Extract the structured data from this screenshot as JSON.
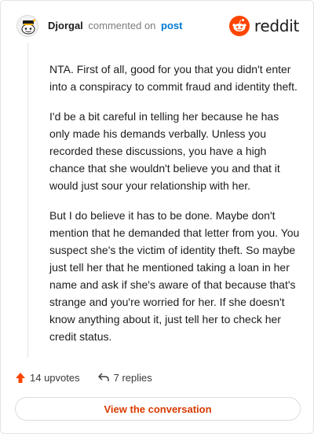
{
  "header": {
    "username": "Djorgal",
    "verb": "commented on",
    "post_link": "post",
    "brand_name": "reddit",
    "brand_color": "#ff4500",
    "avatar_icon": "snoo-avatar-icon"
  },
  "comment": {
    "paragraphs": [
      "NTA. First of all, good for you that you didn't enter into a conspiracy to commit fraud and identity theft.",
      "I'd be a bit careful in telling her because he has only made his demands verbally. Unless you recorded these discussions, you have a high chance that she wouldn't believe you and that it would just sour your relationship with her.",
      "But I do believe it has to be done. Maybe don't mention that he demanded that letter from you. You suspect she's the victim of identity theft. So maybe just tell her that he mentioned taking a loan in her name and ask if she's aware of that because that's strange and you're worried for her. If she doesn't know anything about it, just tell her to check her credit status."
    ]
  },
  "stats": {
    "upvotes": "14 upvotes",
    "replies": "7 replies",
    "upvote_icon": "upvote-arrow-icon",
    "reply_icon": "reply-arrow-icon",
    "upvote_color": "#ff4500"
  },
  "cta": {
    "label": "View the conversation",
    "color": "#d93a00"
  }
}
